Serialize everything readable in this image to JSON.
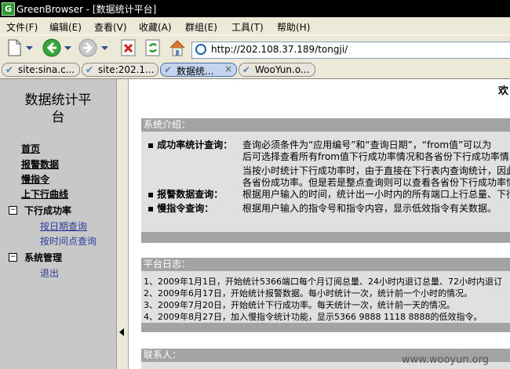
{
  "window": {
    "app_icon": "G",
    "title": "GreenBrowser - [数据统计平台]"
  },
  "menu": [
    "文件(F)",
    "编辑(E)",
    "查看(V)",
    "收藏(A)",
    "群组(E)",
    "工具(T)",
    "帮助(H)"
  ],
  "toolbar": {
    "icons": [
      "new-page-icon",
      "back-icon",
      "forward-icon",
      "stop-icon",
      "refresh-icon",
      "home-icon"
    ],
    "address": "http://202.108.37.189/tongji/"
  },
  "tabs": [
    {
      "label": "site:sina.c...",
      "active": false
    },
    {
      "label": "site:202.1...",
      "active": false
    },
    {
      "label": "数据统...",
      "active": true,
      "close": "×"
    },
    {
      "label": "WooYun.o...",
      "active": false
    }
  ],
  "sidebar": {
    "title": "数据统计平台",
    "links": [
      "首页",
      "报警数据",
      "慢指令",
      "上下行曲线"
    ],
    "groups": [
      {
        "toggle": "−",
        "label": "下行成功率",
        "children": [
          "按日期查询",
          "按时间点查询"
        ]
      },
      {
        "toggle": "−",
        "label": "系统管理",
        "children": [
          "退出"
        ]
      }
    ]
  },
  "content": {
    "welcome": "欢",
    "intro": {
      "header": "系统介绍：",
      "items": [
        {
          "label": "▪ 成功率统计查询：",
          "lines": [
            "查询必须条件为“应用编号”和“查询日期”，“from值”可以为",
            "后可选择查看所有from值下行成功率情况和各省份下行成功率情况",
            "当按小时统计下行成功率时，由于直接在下行表内查询统计，因此",
            "各省份成功率。但是若是整点查询则可以查看各省份下行成功率情况"
          ]
        },
        {
          "label": "▪ 报警数据查询：",
          "lines": [
            "根据用户输入的时间，统计出一小时内的所有端口上行总量、下行"
          ]
        },
        {
          "label": "▪ 慢指令查询：",
          "lines": [
            "根据用户输入的指令号和指令内容，显示低效指令有关数据。"
          ]
        }
      ]
    },
    "log": {
      "header": "平台日志：",
      "lines": [
        "1、2009年1月1日，开始统计5366端口每个月订阅总量、24小时内退订总量、72小时内退订",
        "2、2009年6月17日，开始统计报警数据。每小时统计一次，统计前一个小时的情况。",
        "3、2009年7月20日，开始统计下行成功率。每天统计一次，统计前一天的情况。",
        "4、2009年8月27日，加入慢指令统计功能，显示5366 9888 1118 8888的低效指令。"
      ]
    },
    "contact": {
      "header": "联系人："
    }
  },
  "watermark": "www.wooyun.org"
}
